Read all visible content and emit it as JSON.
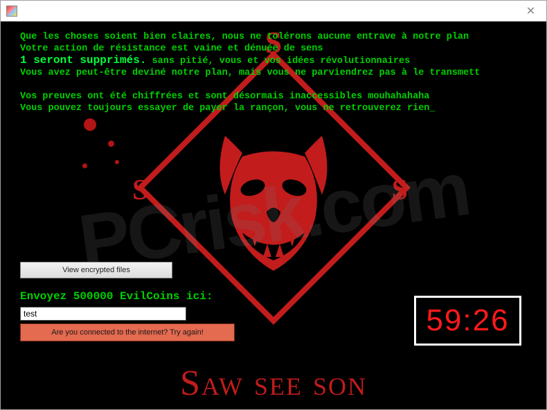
{
  "window": {
    "close_glyph": "✕"
  },
  "ransom": {
    "line1": "Que les choses soient bien claires, nous ne tolérons aucune entrave à notre plan",
    "line2": "Votre action de résistance est vaine et dénuée de sens",
    "line3_bold": "1 seront supprimés.",
    "line3_rest": " sans pitié, vous et vos idées révolutionnaires",
    "line4": "Vous avez peut-être deviné notre plan, mais vous ne parviendrez pas à le transmett",
    "line5": "",
    "line6": "Vos preuves ont été chiffrées et sont désormais inaccessibles mouhahahaha",
    "line7": "Vous pouvez toujours essayer de payer la rançon, vous ne retrouverez rien_"
  },
  "buttons": {
    "view_encrypted": "View encrypted files",
    "error": "Are you connected to the internet? Try again!"
  },
  "payment": {
    "label": "Envoyez 500000 EvilCoins ici:",
    "input_value": "test"
  },
  "timer": {
    "value": "59:26"
  },
  "decor": {
    "s_letter": "S",
    "title": "Saw see son",
    "watermark": "PCrisk.com"
  }
}
